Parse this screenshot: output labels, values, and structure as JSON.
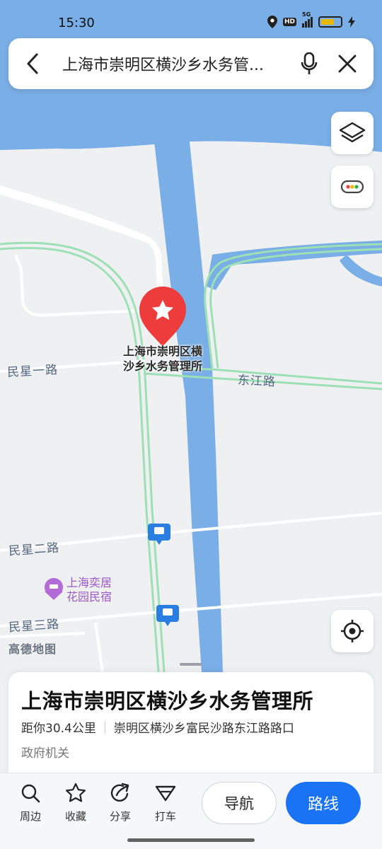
{
  "status_bar": {
    "time": "15:30",
    "network_label": "5G",
    "hd_label": "HD"
  },
  "search": {
    "query": "上海市崇明区横沙乡水务管..."
  },
  "map": {
    "roads": {
      "minxing_1": "民星一路",
      "minxing_2": "民星二路",
      "minxing_3": "民星三路",
      "dongjiang": "东江路"
    },
    "marker_label": "上海市崇明区横沙乡水务管理所",
    "marker_label_line1": "上海市崇明区横",
    "marker_label_line2": "沙乡水务管理所",
    "hotel_line1": "上海奕居",
    "hotel_line2": "花园民宿",
    "logo": "高德地图",
    "colors": {
      "water": "#7aaee6",
      "land": "#eef0f2",
      "road_green": "#9ee0b6",
      "marker": "#ee3b3b"
    }
  },
  "poi_card": {
    "name": "上海市崇明区横沙乡水务管理所",
    "distance": "距你30.4公里",
    "address": "崇明区横沙乡富民沙路东江路路口",
    "category": "政府机关"
  },
  "toolbar": {
    "nearby": "周边",
    "favorite": "收藏",
    "share": "分享",
    "taxi": "打车",
    "navigate": "导航",
    "route": "路线"
  },
  "accent_color": "#1a73f5"
}
